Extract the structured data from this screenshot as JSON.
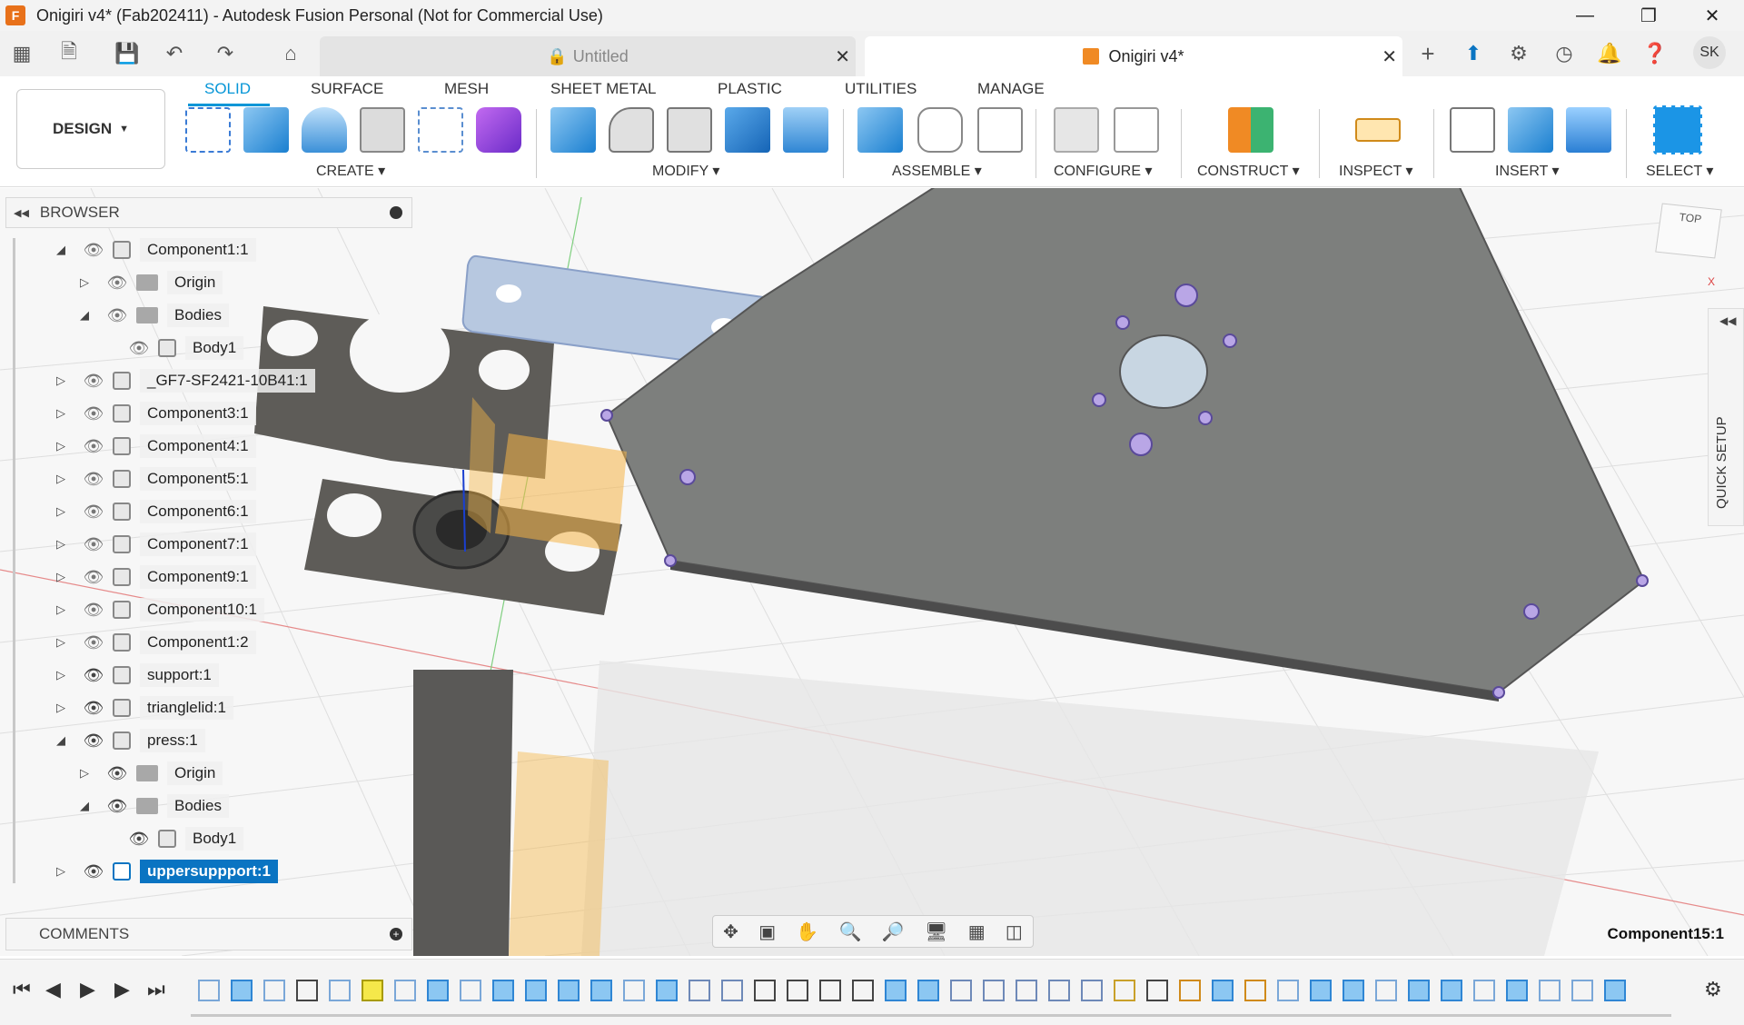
{
  "window": {
    "title": "Onigiri v4* (Fab202411) - Autodesk Fusion Personal (Not for Commercial Use)",
    "logo_letter": "F"
  },
  "quick_access": {
    "icons": [
      "grid-icon",
      "file-icon",
      "save-icon",
      "undo-icon",
      "redo-icon",
      "home-icon"
    ]
  },
  "doc_tabs": [
    {
      "label": "Untitled",
      "active": false,
      "icon": "lock-icon"
    },
    {
      "label": "Onigiri v4*",
      "active": true,
      "icon": "cube-icon"
    }
  ],
  "user": {
    "initials": "SK"
  },
  "ribbon": {
    "tabs": [
      "SOLID",
      "SURFACE",
      "MESH",
      "SHEET METAL",
      "PLASTIC",
      "UTILITIES",
      "MANAGE"
    ],
    "active_tab": "SOLID",
    "workspace": "DESIGN",
    "groups": [
      "CREATE",
      "MODIFY",
      "ASSEMBLE",
      "CONFIGURE",
      "CONSTRUCT",
      "INSPECT",
      "INSERT",
      "SELECT"
    ]
  },
  "browser": {
    "title": "BROWSER",
    "items": [
      {
        "label": "Component1:1",
        "level": 0,
        "expanded": true,
        "visible": false,
        "type": "component"
      },
      {
        "label": "Origin",
        "level": 1,
        "expanded": false,
        "visible": false,
        "type": "folder"
      },
      {
        "label": "Bodies",
        "level": 1,
        "expanded": true,
        "visible": false,
        "type": "folder"
      },
      {
        "label": "Body1",
        "level": 2,
        "expanded": null,
        "visible": false,
        "type": "body"
      },
      {
        "label": "_GF7-SF2421-10B41:1",
        "level": 0,
        "expanded": false,
        "visible": false,
        "type": "component"
      },
      {
        "label": "Component3:1",
        "level": 0,
        "expanded": false,
        "visible": false,
        "type": "component"
      },
      {
        "label": "Component4:1",
        "level": 0,
        "expanded": false,
        "visible": false,
        "type": "component"
      },
      {
        "label": "Component5:1",
        "level": 0,
        "expanded": false,
        "visible": false,
        "type": "component"
      },
      {
        "label": "Component6:1",
        "level": 0,
        "expanded": false,
        "visible": false,
        "type": "component"
      },
      {
        "label": "Component7:1",
        "level": 0,
        "expanded": false,
        "visible": false,
        "type": "component"
      },
      {
        "label": "Component9:1",
        "level": 0,
        "expanded": false,
        "visible": false,
        "type": "component"
      },
      {
        "label": "Component10:1",
        "level": 0,
        "expanded": false,
        "visible": false,
        "type": "component"
      },
      {
        "label": "Component1:2",
        "level": 0,
        "expanded": false,
        "visible": false,
        "type": "component"
      },
      {
        "label": "support:1",
        "level": 0,
        "expanded": false,
        "visible": true,
        "type": "component"
      },
      {
        "label": "trianglelid:1",
        "level": 0,
        "expanded": false,
        "visible": true,
        "type": "component"
      },
      {
        "label": "press:1",
        "level": 0,
        "expanded": true,
        "visible": true,
        "type": "component"
      },
      {
        "label": "Origin",
        "level": 1,
        "expanded": false,
        "visible": true,
        "type": "folder"
      },
      {
        "label": "Bodies",
        "level": 1,
        "expanded": true,
        "visible": true,
        "type": "folder"
      },
      {
        "label": "Body1",
        "level": 2,
        "expanded": null,
        "visible": true,
        "type": "body"
      },
      {
        "label": "uppersuppport:1",
        "level": 0,
        "expanded": false,
        "visible": true,
        "type": "component",
        "selected": true
      }
    ]
  },
  "comments": {
    "title": "COMMENTS"
  },
  "status": {
    "component": "Component15:1"
  },
  "view_cube": {
    "face": "TOP",
    "axis_x": "X"
  },
  "quick_setup": {
    "label": "QUICK SETUP"
  },
  "colors": {
    "accent": "#0696d7",
    "selection": "#0a74c2",
    "plate": "#7d7f7d"
  }
}
